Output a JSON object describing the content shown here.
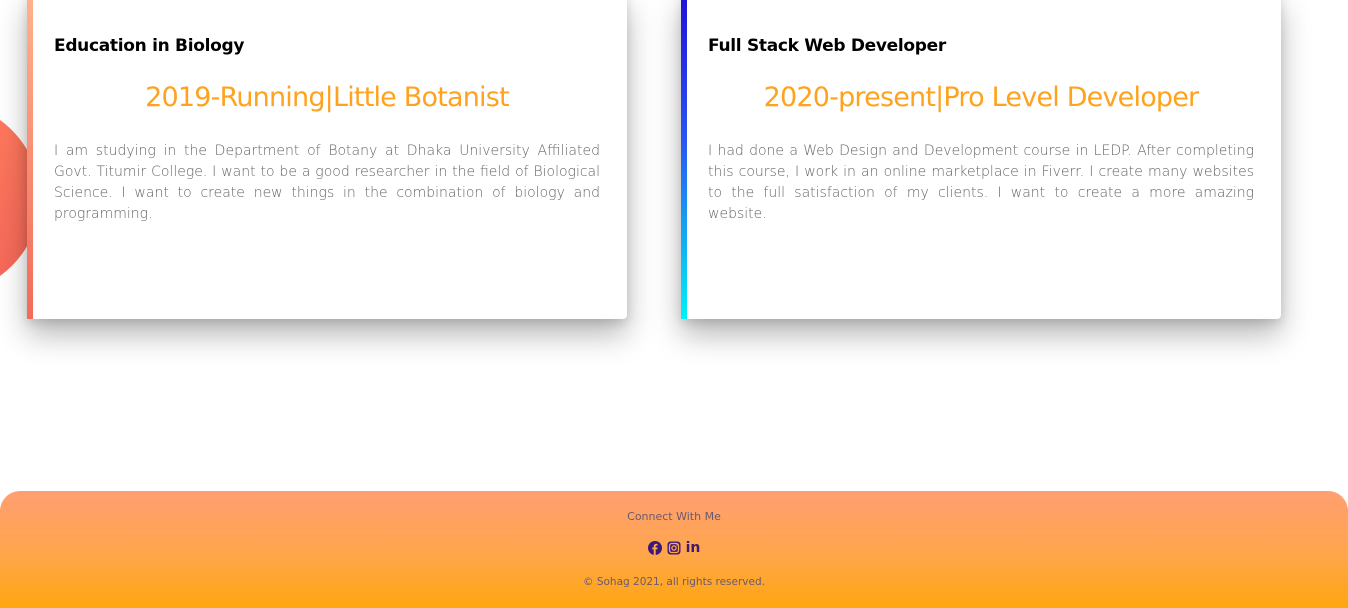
{
  "cards": [
    {
      "heading": "Education in Biology",
      "subtitle": "2019-Running|Little Botanist",
      "text": "I am studying in the Department of Botany at Dhaka University Affiliated Govt. Titumir College. I want to be a good researcher in the field of Biological Science. I want to create new things in the combination of biology and programming."
    },
    {
      "heading": "Full Stack Web Developer",
      "subtitle": "2020-present|Pro Level Developer",
      "text": "I had done a Web Design and Development course in LEDP. After completing this course, I work in an online marketplace in Fiverr. I create many websites to the full satisfaction of my clients. I want to create a more amazing website."
    }
  ],
  "footer": {
    "connect_label": "Connect With Me",
    "social": [
      {
        "icon": "facebook-icon"
      },
      {
        "icon": "instagram-icon"
      },
      {
        "icon": "linkedin-icon",
        "glyph": "in"
      }
    ],
    "copyright": "© Sohag 2021, all rights reserved."
  },
  "colors": {
    "subtitle_accent": "#ffa21d",
    "footer_gradient_top": "#ff9f72",
    "footer_gradient_bottom": "#ffa60f",
    "social_icon": "#3d1a78"
  }
}
